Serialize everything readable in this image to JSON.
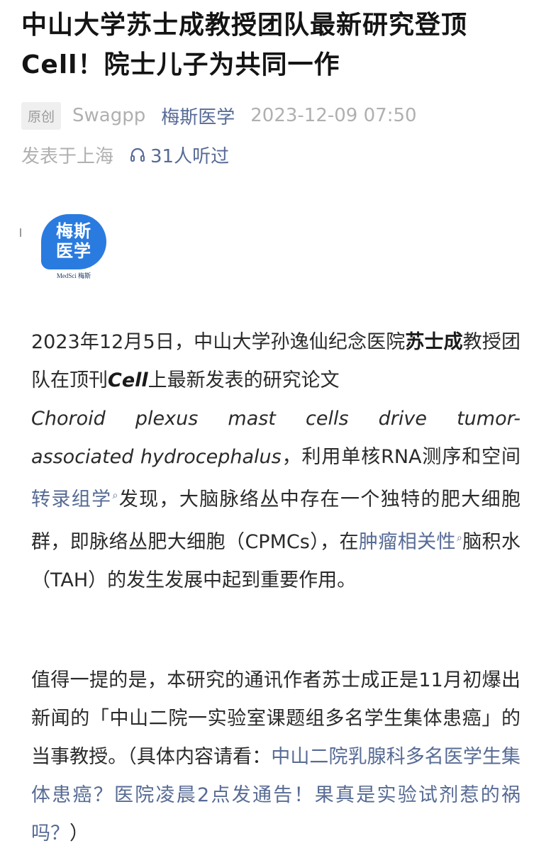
{
  "article": {
    "title": "中山大学苏士成教授团队最新研究登顶Cell！院士儿子为共同一作",
    "original_tag": "原创",
    "author": "Swagpp",
    "account": "梅斯医学",
    "datetime": "2023-12-09 07:50",
    "location": "发表于上海",
    "listen_count": "31人听过",
    "logo_text_line1": "梅斯",
    "logo_text_line2": "医学",
    "logo_caption": "MedSci 梅斯",
    "p1": {
      "s1": "2023年12月5日，中山大学孙逸仙纪念医院",
      "s2": "苏士成",
      "s3": "教授团队在顶刊",
      "s4": "Cell",
      "s5": "上最新发表的研究论文",
      "s6a": "Choroid",
      "s6b": "plexus",
      "s6c": "mast",
      "s6d": "cells",
      "s6e": "drive",
      "s6f": "tumor-",
      "s7": "associated hydrocephalus",
      "s8": "，利用单核RNA测序和空间",
      "link1": "转录组学",
      "s9": "发现，大脑脉络丛中存在一个独特的肥大细胞群，即脉络丛肥大细胞（CPMCs），在",
      "link2": "肿瘤相关性",
      "s10": "脑积水（TAH）的发生发展中起到重要作用。"
    },
    "p2": {
      "s1": "值得一提的是，本研究的通讯作者苏士成正是11月初爆出新闻的「中山二院一实验室课题组多名学生集体患癌」的当事教授。（具体内容请看：",
      "link": "中山二院乳腺科多名医学生集体患癌？医院凌晨2点发通告！果真是实验试剂惹的祸吗？",
      "s2": "）"
    },
    "icons": [
      "headphones-icon",
      "search-icon"
    ],
    "colors": {
      "link": "#576b95",
      "meta": "#b0b0b0",
      "logo": "#2a7be0"
    }
  }
}
